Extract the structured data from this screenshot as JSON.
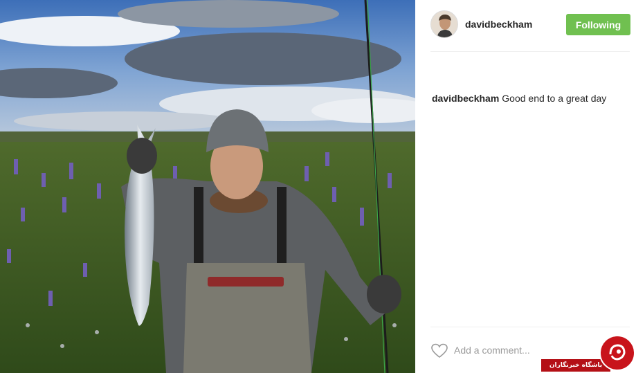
{
  "post": {
    "photo_description": "Man in a grey beanie and waders holding a fish in a field of lupines beside a fishing rod"
  },
  "header": {
    "username": "davidbeckham",
    "follow_label": "Following"
  },
  "caption": {
    "username": "davidbeckham",
    "text": "Good end to a great day"
  },
  "comment": {
    "placeholder": "Add a comment..."
  },
  "watermark": {
    "text": "باشگاه خبرنگاران"
  },
  "colors": {
    "follow_button": "#70c050",
    "watermark_red": "#c8141b"
  }
}
